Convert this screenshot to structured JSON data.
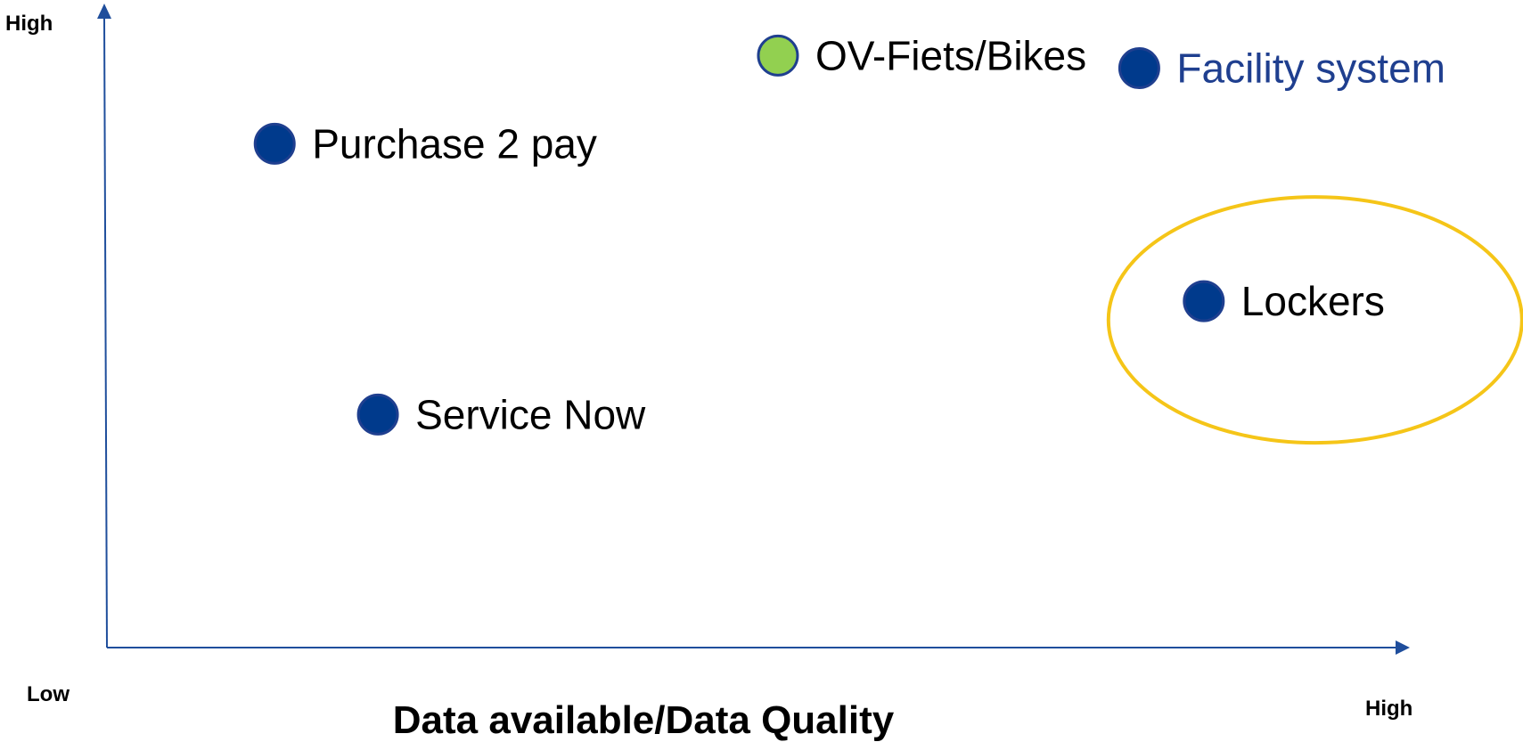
{
  "chart_data": {
    "type": "scatter",
    "title": "",
    "xlabel": "Data available/Data Quality",
    "ylabel": "",
    "x_ticks": {
      "low": "Low",
      "high": "High"
    },
    "y_ticks": {
      "high": "High"
    },
    "xlim": [
      0,
      100
    ],
    "ylim": [
      0,
      100
    ],
    "grid": false,
    "points": [
      {
        "label": "Purchase 2 pay",
        "x": 13,
        "y": 80,
        "color": "#003a8c",
        "label_color": "#000000",
        "label_side": "right"
      },
      {
        "label": "OV-Fiets/Bikes",
        "x": 52,
        "y": 94,
        "color": "#92d050",
        "label_color": "#000000",
        "label_side": "right"
      },
      {
        "label": "Facility system",
        "x": 80,
        "y": 92,
        "color": "#003a8c",
        "label_color": "#1f3f8f",
        "label_side": "right"
      },
      {
        "label": "Lockers",
        "x": 85,
        "y": 55,
        "color": "#003a8c",
        "label_color": "#000000",
        "label_side": "right",
        "highlighted": true
      },
      {
        "label": "Service Now",
        "x": 21,
        "y": 37,
        "color": "#003a8c",
        "label_color": "#000000",
        "label_side": "right"
      }
    ],
    "highlight_color": "#f5c518",
    "axis_color": "#1f4e9c"
  }
}
